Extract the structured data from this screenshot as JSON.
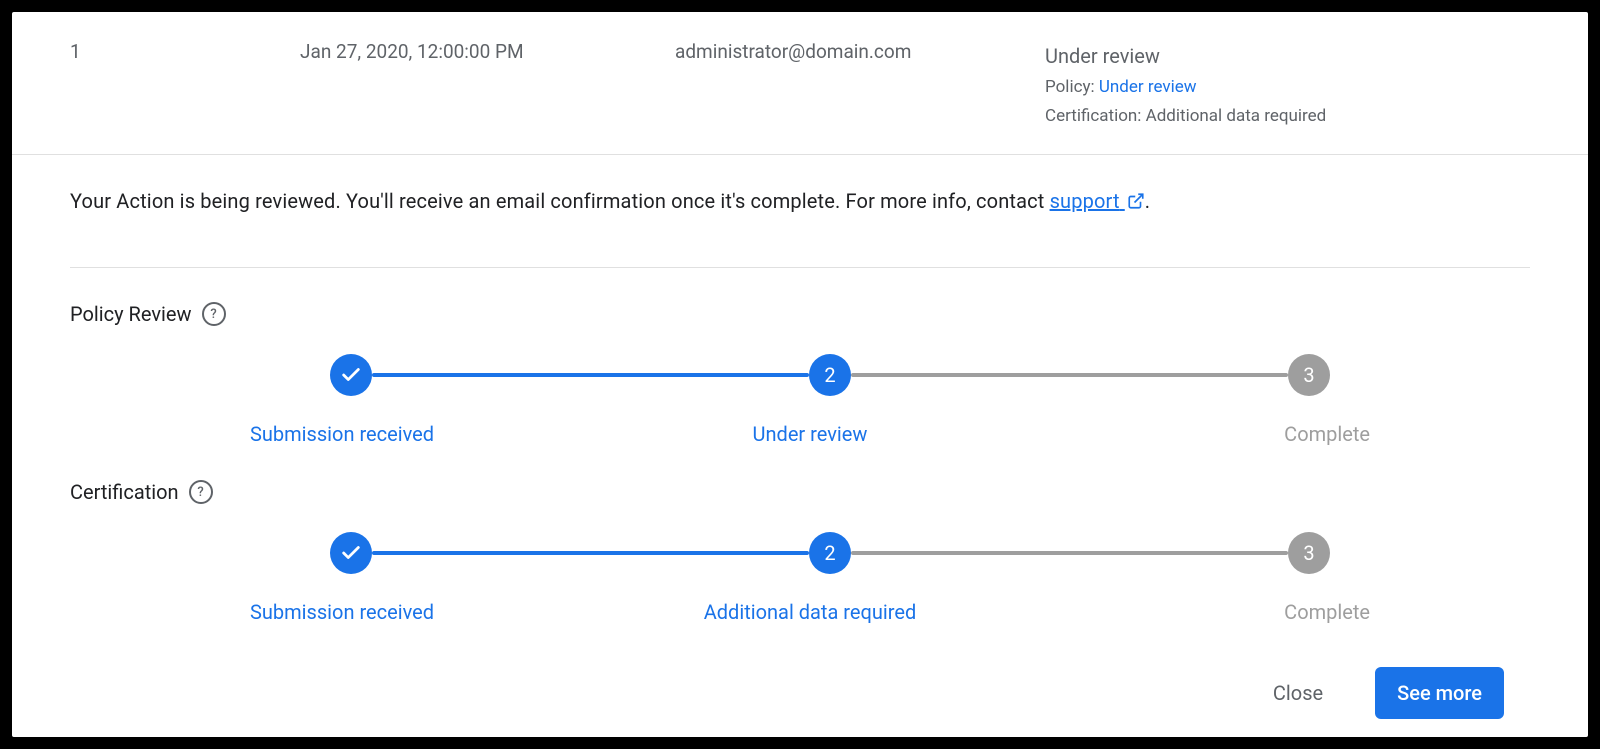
{
  "row": {
    "id": "1",
    "date": "Jan 27, 2020, 12:00:00 PM",
    "email": "administrator@domain.com",
    "status_line1": "Under review",
    "status_policy_label": "Policy: ",
    "status_policy_value": "Under review",
    "status_cert_label": "Certification: Additional data required"
  },
  "notice": {
    "text_before": "Your Action is being reviewed. You'll receive an email confirmation once it's complete. For more info, contact ",
    "link": "support",
    "text_after": "."
  },
  "sections": {
    "policy_review": {
      "title": "Policy Review"
    },
    "certification": {
      "title": "Certification"
    }
  },
  "steppers": {
    "policy": {
      "s1": "Submission received",
      "s2": "Under review",
      "s3": "Complete",
      "n2": "2",
      "n3": "3"
    },
    "cert": {
      "s1": "Submission received",
      "s2": "Additional data required",
      "s3": "Complete",
      "n2": "2",
      "n3": "3"
    }
  },
  "footer": {
    "close": "Close",
    "see_more": "See more"
  }
}
